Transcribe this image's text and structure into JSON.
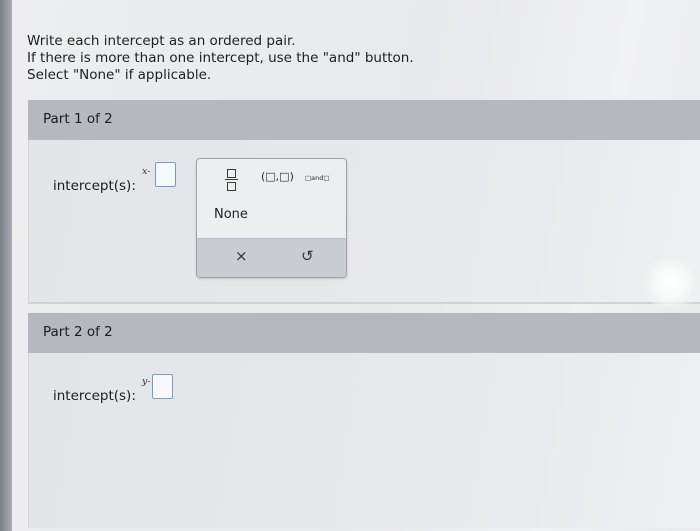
{
  "instructions": {
    "line1": "Write each intercept as an ordered pair.",
    "line2": "If there is more than one intercept, use the \"and\" button.",
    "line3": "Select \"None\" if applicable."
  },
  "part1": {
    "title": "Part 1 of 2",
    "var": "x-",
    "label": "intercept(s):"
  },
  "part2": {
    "title": "Part 2 of 2",
    "var": "y-",
    "label": "intercept(s):"
  },
  "keypad": {
    "ordered_pair": "(□,□)",
    "and_template": "□and□",
    "none": "None",
    "clear": "×",
    "undo": "↺",
    "icons": [
      "fraction-icon",
      "clear-icon",
      "undo-icon"
    ]
  }
}
